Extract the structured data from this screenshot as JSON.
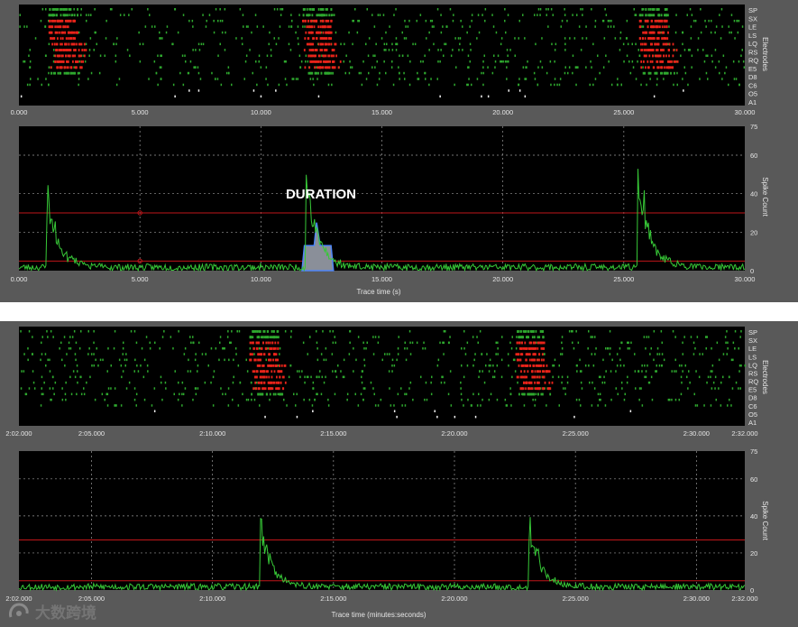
{
  "colors": {
    "panel_bg": "#595959",
    "plot_bg": "#000000",
    "grid": "#9a9a9a",
    "burst_spike": "#e8241a",
    "spike": "#2ea82e",
    "low_spike": "#f2f2f2",
    "threshold_line": "#c0161a",
    "histogram": "#37c837",
    "duration_fill": "#8a8f99",
    "duration_outline": "#4f86f7"
  },
  "watermark": {
    "text": "大数跨境"
  },
  "chart_data": [
    {
      "type": "raster",
      "electrode_axis_label": "Electrodes",
      "xlim": [
        0,
        30
      ],
      "x_ticks": [
        "0.000",
        "5.000",
        "10.000",
        "15.000",
        "20.000",
        "25.000",
        "30.000"
      ],
      "y_tick_labels": [
        "SP",
        "SX",
        "LE",
        "LS",
        "LQ",
        "RS",
        "RQ",
        "E5",
        "D8",
        "C6",
        "O5",
        "A1"
      ],
      "burst_times": [
        1.8,
        12.3,
        26.2
      ],
      "electrode_count": 16
    },
    {
      "type": "histogram",
      "xlabel": "Trace time (s)",
      "ylabel": "Spike Count",
      "xlim": [
        0,
        30
      ],
      "ylim": [
        0,
        75
      ],
      "x_ticks": [
        "0.000",
        "5.000",
        "10.000",
        "15.000",
        "20.000",
        "25.000",
        "30.000"
      ],
      "y_ticks": [
        "0",
        "20",
        "40",
        "60",
        "75"
      ],
      "y_tick_values": [
        0,
        20,
        40,
        60,
        75
      ],
      "threshold_lines": [
        30,
        5
      ],
      "threshold_markers": [
        {
          "x": 5,
          "y": 30
        },
        {
          "x": 5,
          "y": 5
        }
      ],
      "peaks": [
        {
          "x": 1.2,
          "y": 42
        },
        {
          "x": 11.9,
          "y": 53
        },
        {
          "x": 25.6,
          "y": 60
        }
      ],
      "duration_region": {
        "x_start": 11.7,
        "x_end": 13.0,
        "height": 13,
        "peak_x": 12.3,
        "peak_y": 25
      },
      "annotation": "DURATION"
    },
    {
      "type": "raster",
      "electrode_axis_label": "Electrodes",
      "xlim_seconds": [
        122,
        152
      ],
      "x_ticks": [
        "2:02.000",
        "2:05.000",
        "2:10.000",
        "2:15.000",
        "2:20.000",
        "2:25.000",
        "2:30.000",
        "2:32.000"
      ],
      "x_tick_values": [
        122,
        125,
        130,
        135,
        140,
        145,
        150,
        152
      ],
      "y_tick_labels": [
        "SP",
        "SX",
        "LE",
        "LS",
        "LQ",
        "RS",
        "RQ",
        "E5",
        "D8",
        "C6",
        "O5",
        "A1"
      ],
      "burst_times": [
        132.1,
        143.1
      ],
      "electrode_count": 16
    },
    {
      "type": "histogram",
      "xlabel": "Trace time (minutes:seconds)",
      "ylabel": "Spike Count",
      "xlim_seconds": [
        122,
        152
      ],
      "ylim": [
        0,
        75
      ],
      "x_ticks": [
        "2:02.000",
        "2:05.000",
        "2:10.000",
        "2:15.000",
        "2:20.000",
        "2:25.000",
        "2:30.000",
        "2:32.000"
      ],
      "x_tick_values": [
        122,
        125,
        130,
        135,
        140,
        145,
        150,
        152
      ],
      "y_ticks": [
        "0",
        "20",
        "40",
        "60",
        "75"
      ],
      "y_tick_values": [
        0,
        20,
        40,
        60,
        75
      ],
      "threshold_lines": [
        27,
        5
      ],
      "peaks": [
        {
          "x": 132.0,
          "y": 38
        },
        {
          "x": 143.1,
          "y": 39
        }
      ]
    }
  ]
}
